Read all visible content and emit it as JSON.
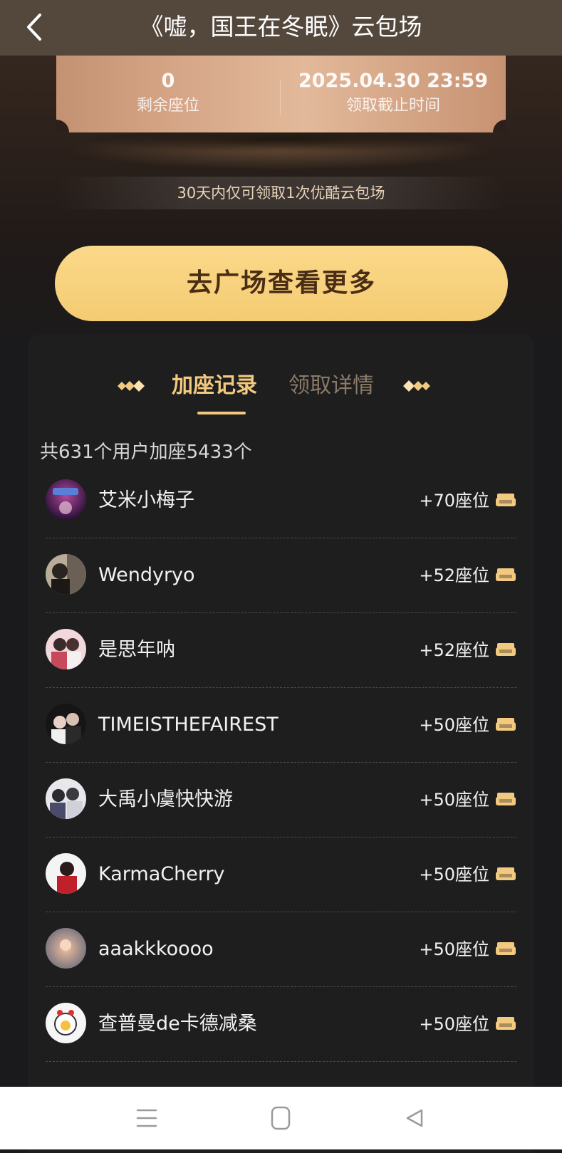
{
  "header": {
    "title": "《嘘，国王在冬眠》云包场",
    "back_icon": "chevron-left-icon"
  },
  "ticket": {
    "remaining_value": "0",
    "remaining_label": "剩余座位",
    "deadline_value": "2025.04.30 23:59",
    "deadline_label": "领取截止时间"
  },
  "notice": "30天内仅可领取1次优酷云包场",
  "cta_label": "去广场查看更多",
  "tabs": [
    {
      "label": "加座记录",
      "active": true
    },
    {
      "label": "领取详情",
      "active": false
    }
  ],
  "summary": "共631个用户加座5433个",
  "records": [
    {
      "name": "艾米小梅子",
      "seats": "+70座位"
    },
    {
      "name": "Wendyryo",
      "seats": "+52座位"
    },
    {
      "name": "是思年呐",
      "seats": "+52座位"
    },
    {
      "name": "TIMEISTHEFAIREST",
      "seats": "+50座位"
    },
    {
      "name": "大禹小虞快快游",
      "seats": "+50座位"
    },
    {
      "name": "KarmaCherry",
      "seats": "+50座位"
    },
    {
      "name": "aaakkkoooo",
      "seats": "+50座位"
    },
    {
      "name": "查普曼de卡德减桑",
      "seats": "+50座位"
    }
  ],
  "colors": {
    "accent_gold": "#f3c980",
    "cta": "#f6cf7a",
    "panel": "#1e1e1e"
  },
  "navbar": {
    "icons": [
      "menu-icon",
      "home-icon",
      "back-triangle-icon"
    ]
  }
}
